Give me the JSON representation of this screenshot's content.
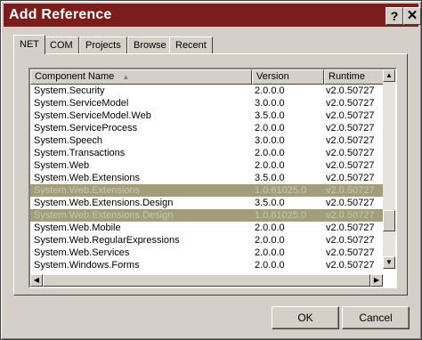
{
  "window": {
    "title": "Add Reference",
    "help_label": "?",
    "close_label": "✕"
  },
  "tabs": [
    {
      "label": "NET",
      "active": true
    },
    {
      "label": "COM",
      "active": false
    },
    {
      "label": "Projects",
      "active": false
    },
    {
      "label": "Browse",
      "active": false
    },
    {
      "label": "Recent",
      "active": false
    }
  ],
  "list": {
    "columns": [
      "Component Name",
      "Version",
      "Runtime"
    ],
    "sort_indicator": "▲",
    "rows": [
      {
        "name": "System.Security",
        "version": "2.0.0.0",
        "runtime": "v2.0.50727",
        "selected": false
      },
      {
        "name": "System.ServiceModel",
        "version": "3.0.0.0",
        "runtime": "v2.0.50727",
        "selected": false
      },
      {
        "name": "System.ServiceModel.Web",
        "version": "3.5.0.0",
        "runtime": "v2.0.50727",
        "selected": false
      },
      {
        "name": "System.ServiceProcess",
        "version": "2.0.0.0",
        "runtime": "v2.0.50727",
        "selected": false
      },
      {
        "name": "System.Speech",
        "version": "3.0.0.0",
        "runtime": "v2.0.50727",
        "selected": false
      },
      {
        "name": "System.Transactions",
        "version": "2.0.0.0",
        "runtime": "v2.0.50727",
        "selected": false
      },
      {
        "name": "System.Web",
        "version": "2.0.0.0",
        "runtime": "v2.0.50727",
        "selected": false
      },
      {
        "name": "System.Web.Extensions",
        "version": "3.5.0.0",
        "runtime": "v2.0.50727",
        "selected": false
      },
      {
        "name": "System.Web.Extensions",
        "version": "1.0.61025.0",
        "runtime": "v2.0.50727",
        "selected": true
      },
      {
        "name": "System.Web.Extensions.Design",
        "version": "3.5.0.0",
        "runtime": "v2.0.50727",
        "selected": false
      },
      {
        "name": "System.Web.Extensions.Design",
        "version": "1.0.61025.0",
        "runtime": "v2.0.50727",
        "selected": true
      },
      {
        "name": "System.Web.Mobile",
        "version": "2.0.0.0",
        "runtime": "v2.0.50727",
        "selected": false
      },
      {
        "name": "System.Web.RegularExpressions",
        "version": "2.0.0.0",
        "runtime": "v2.0.50727",
        "selected": false
      },
      {
        "name": "System.Web.Services",
        "version": "2.0.0.0",
        "runtime": "v2.0.50727",
        "selected": false
      },
      {
        "name": "System.Windows.Forms",
        "version": "2.0.0.0",
        "runtime": "v2.0.50727",
        "selected": false
      }
    ]
  },
  "icons": {
    "scroll_up": "▲",
    "scroll_down": "▼",
    "scroll_left": "◀",
    "scroll_right": "▶"
  },
  "colors": {
    "titlebar": "#7c1c1c",
    "selection": "#a29e7a",
    "face": "#d4d0c8"
  },
  "buttons": {
    "ok_label": "OK",
    "cancel_label": "Cancel"
  }
}
